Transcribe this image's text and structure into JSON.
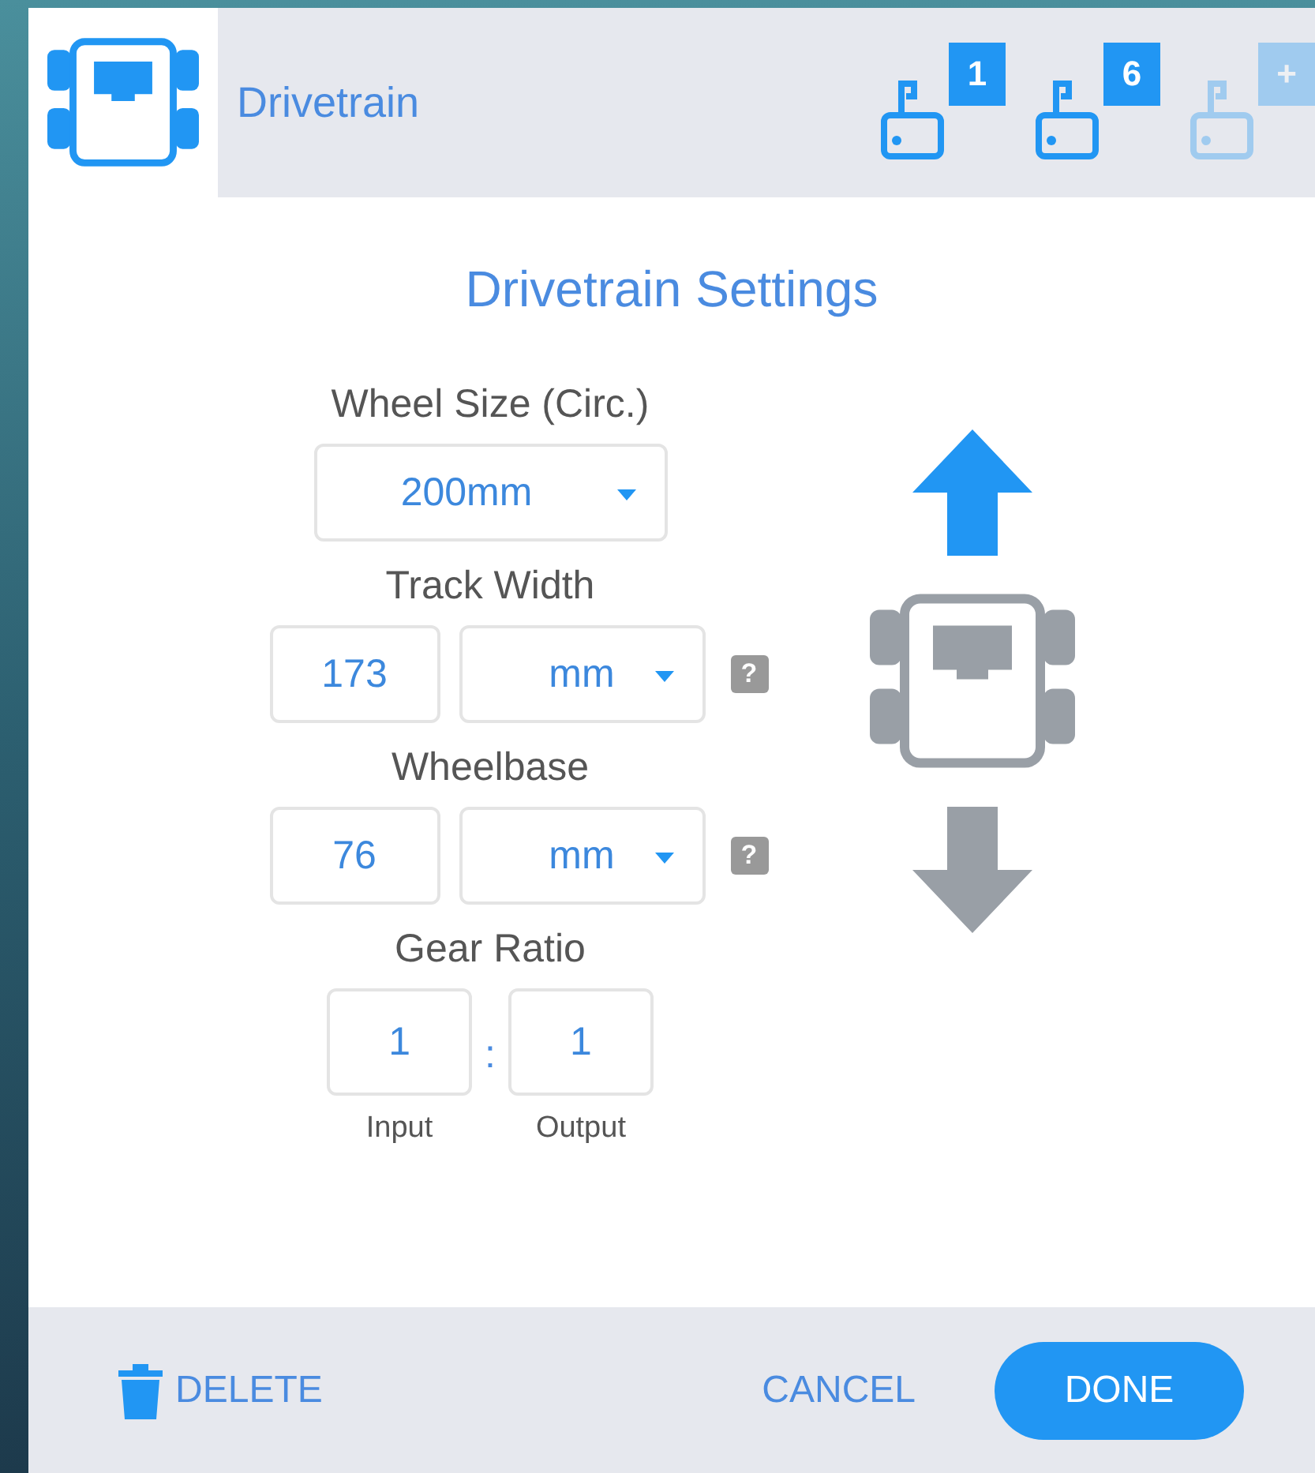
{
  "header": {
    "title": "Drivetrain",
    "ports": [
      {
        "label": "1",
        "disabled": false
      },
      {
        "label": "6",
        "disabled": false
      },
      {
        "label": "+",
        "disabled": true
      }
    ]
  },
  "settings": {
    "title": "Drivetrain Settings",
    "wheel_size": {
      "label": "Wheel Size (Circ.)",
      "value": "200mm"
    },
    "track_width": {
      "label": "Track Width",
      "value": "173",
      "unit": "mm",
      "help": "?"
    },
    "wheelbase": {
      "label": "Wheelbase",
      "value": "76",
      "unit": "mm",
      "help": "?"
    },
    "gear_ratio": {
      "label": "Gear Ratio",
      "input": "1",
      "separator": ":",
      "output": "1",
      "input_label": "Input",
      "output_label": "Output"
    }
  },
  "direction": [
    {
      "kind": "forward",
      "selected": true
    },
    {
      "kind": "reverse",
      "selected": false
    }
  ],
  "footer": {
    "delete": "DELETE",
    "cancel": "CANCEL",
    "done": "DONE"
  }
}
